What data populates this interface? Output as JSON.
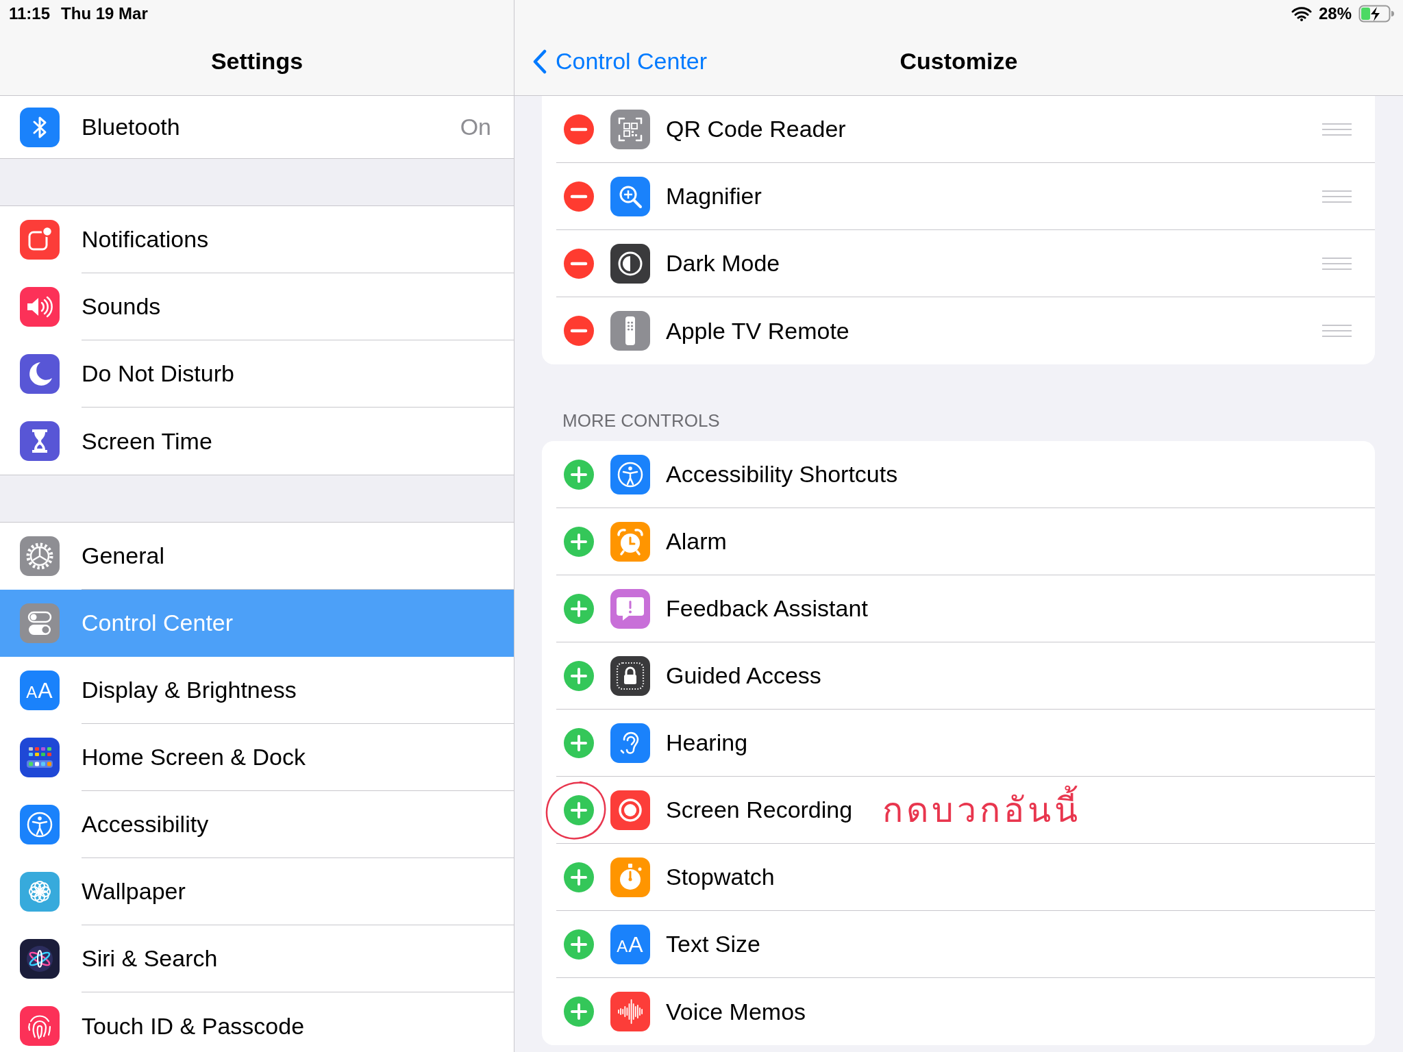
{
  "status_bar": {
    "time": "11:15",
    "date": "Thu 19 Mar",
    "battery": "28%"
  },
  "sidebar": {
    "title": "Settings",
    "groups": [
      {
        "items": [
          {
            "label": "Bluetooth",
            "value": "On",
            "selected": false
          }
        ]
      },
      {
        "items": [
          {
            "label": "Notifications",
            "selected": false
          },
          {
            "label": "Sounds",
            "selected": false
          },
          {
            "label": "Do Not Disturb",
            "selected": false
          },
          {
            "label": "Screen Time",
            "selected": false
          }
        ]
      },
      {
        "items": [
          {
            "label": "General",
            "selected": false
          },
          {
            "label": "Control Center",
            "selected": true
          },
          {
            "label": "Display & Brightness",
            "icon_text": "AA",
            "selected": false
          },
          {
            "label": "Home Screen & Dock",
            "selected": false
          },
          {
            "label": "Accessibility",
            "selected": false
          },
          {
            "label": "Wallpaper",
            "selected": false
          },
          {
            "label": "Siri & Search",
            "selected": false
          },
          {
            "label": "Touch ID & Passcode",
            "selected": false
          }
        ]
      }
    ]
  },
  "detail": {
    "back": "Control Center",
    "title": "Customize",
    "sections": [
      {
        "kind": "included",
        "items": [
          {
            "label": "QR Code Reader"
          },
          {
            "label": "Magnifier"
          },
          {
            "label": "Dark Mode"
          },
          {
            "label": "Apple TV Remote"
          }
        ]
      },
      {
        "kind": "more",
        "header": "MORE CONTROLS",
        "items": [
          {
            "label": "Accessibility Shortcuts",
            "circled": false
          },
          {
            "label": "Alarm",
            "circled": false
          },
          {
            "label": "Feedback Assistant",
            "circled": false
          },
          {
            "label": "Guided Access",
            "circled": false
          },
          {
            "label": "Hearing",
            "circled": false
          },
          {
            "label": "Screen Recording",
            "circled": true,
            "note": "กดบวกอันนี้"
          },
          {
            "label": "Stopwatch",
            "circled": false
          },
          {
            "label": "Text Size",
            "icon_text": "AA",
            "circled": false
          },
          {
            "label": "Voice Memos",
            "circled": false
          }
        ]
      }
    ]
  }
}
